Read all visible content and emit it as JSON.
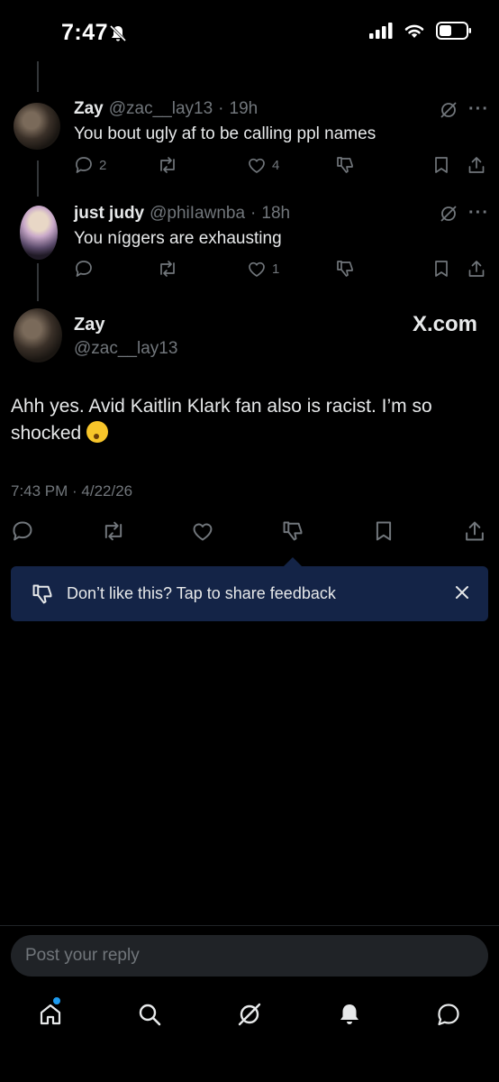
{
  "status": {
    "time": "7:47"
  },
  "replies": [
    {
      "name": "Zay",
      "handle": "@zac__lay13",
      "sep": "·",
      "time": "19h",
      "text": "You bout ugly af to be calling ppl names",
      "reply_count": "2",
      "repost_count": "",
      "like_count": "4"
    },
    {
      "name": "just judy",
      "handle": "@phiIawnba",
      "sep": "·",
      "time": "18h",
      "text": "You níggers are exhausting",
      "reply_count": "",
      "repost_count": "",
      "like_count": "1"
    }
  ],
  "main_post": {
    "name": "Zay",
    "handle": "@zac__lay13",
    "watermark": "X.com",
    "text": "Ahh yes. Avid Kaitlin Klark fan also is racist. I’m so shocked",
    "timestamp": "7:43 PM · 4/22/26"
  },
  "feedback_banner": {
    "text": "Don’t like this? Tap to share feedback"
  },
  "reply_box": {
    "placeholder": "Post your reply"
  },
  "tabs": [
    "home-icon",
    "search-icon",
    "grok-icon",
    "notifications-icon",
    "messages-icon"
  ],
  "colors": {
    "background": "#000000",
    "muted": "#71767b",
    "banner": "#142447",
    "accent": "#1d9bf0"
  }
}
